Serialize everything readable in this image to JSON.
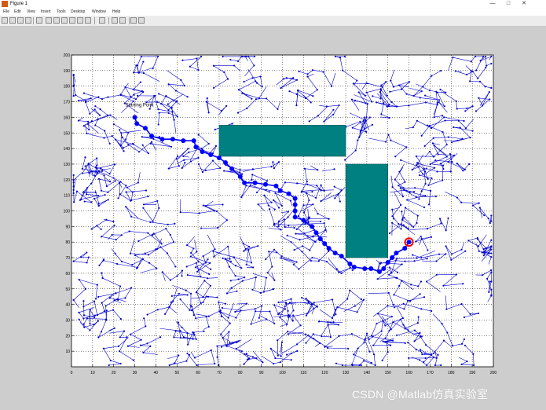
{
  "window": {
    "title": "Figure 1",
    "controls": {
      "minimize": "—",
      "maximize": "□",
      "close": "✕"
    }
  },
  "menu": [
    "File",
    "Edit",
    "View",
    "Insert",
    "Tools",
    "Desktop",
    "Window",
    "Help"
  ],
  "toolbar_icons": [
    "new-icon",
    "open-icon",
    "save-icon",
    "print-icon",
    "arrow-icon",
    "zoom-in-icon",
    "zoom-out-icon",
    "pan-icon",
    "rotate-icon",
    "data-cursor-icon",
    "brush-icon",
    "link-icon",
    "colorbar-icon",
    "legend-icon",
    "hide-plot-tools-icon",
    "show-plot-tools-icon"
  ],
  "watermark": "CSDN @Matlab仿真实验室",
  "colors": {
    "figure_bg": "#cdcdcd",
    "axes_bg": "#ffffff",
    "tree": "#0000cc",
    "path": "#0000ff",
    "obstacle": "#008080",
    "goal": "#ff0000"
  },
  "chart_data": {
    "type": "scatter",
    "title": "",
    "xlabel": "",
    "ylabel": "",
    "xlim": [
      0,
      200
    ],
    "ylim": [
      0,
      200
    ],
    "xticks": [
      0,
      10,
      20,
      30,
      40,
      50,
      60,
      70,
      80,
      90,
      100,
      110,
      120,
      130,
      140,
      150,
      160,
      170,
      180,
      190,
      200
    ],
    "yticks": [
      10,
      20,
      30,
      40,
      50,
      60,
      70,
      80,
      90,
      100,
      110,
      120,
      130,
      140,
      150,
      160,
      170,
      180,
      190,
      200
    ],
    "grid": true,
    "annotations": [
      {
        "text": "Starting Point",
        "x": 30,
        "y": 167
      }
    ],
    "start": {
      "x": 30,
      "y": 160
    },
    "goal": {
      "x": 160,
      "y": 80
    },
    "obstacles": [
      {
        "x1": 70,
        "y1": 135,
        "x2": 130,
        "y2": 155
      },
      {
        "x1": 130,
        "y1": 70,
        "x2": 150,
        "y2": 130
      }
    ],
    "series": [
      {
        "values": [
          [
            30,
            160
          ],
          [
            31,
            156
          ],
          [
            35,
            153
          ],
          [
            38,
            148
          ],
          [
            43,
            146
          ],
          [
            48,
            146
          ],
          [
            53,
            145
          ],
          [
            58,
            145
          ],
          [
            59,
            141
          ],
          [
            62,
            138
          ],
          [
            66,
            136
          ],
          [
            70,
            134
          ],
          [
            73,
            131
          ],
          [
            76,
            127
          ],
          [
            80,
            122
          ],
          [
            82,
            118
          ],
          [
            87,
            118
          ],
          [
            92,
            117
          ],
          [
            97,
            116
          ],
          [
            99,
            113
          ],
          [
            103,
            111
          ],
          [
            106,
            108
          ],
          [
            106,
            104
          ],
          [
            106,
            100
          ],
          [
            106,
            96
          ],
          [
            110,
            94
          ],
          [
            114,
            90
          ],
          [
            116,
            86
          ],
          [
            118,
            82
          ],
          [
            120,
            79
          ],
          [
            122,
            76
          ],
          [
            125,
            73
          ],
          [
            128,
            71
          ],
          [
            132,
            66
          ],
          [
            134,
            64
          ],
          [
            139,
            63
          ],
          [
            142,
            63
          ],
          [
            146,
            61
          ],
          [
            148,
            63
          ],
          [
            150,
            67
          ],
          [
            152,
            70
          ],
          [
            154,
            73
          ],
          [
            158,
            76
          ],
          [
            160,
            80
          ]
        ]
      }
    ]
  }
}
